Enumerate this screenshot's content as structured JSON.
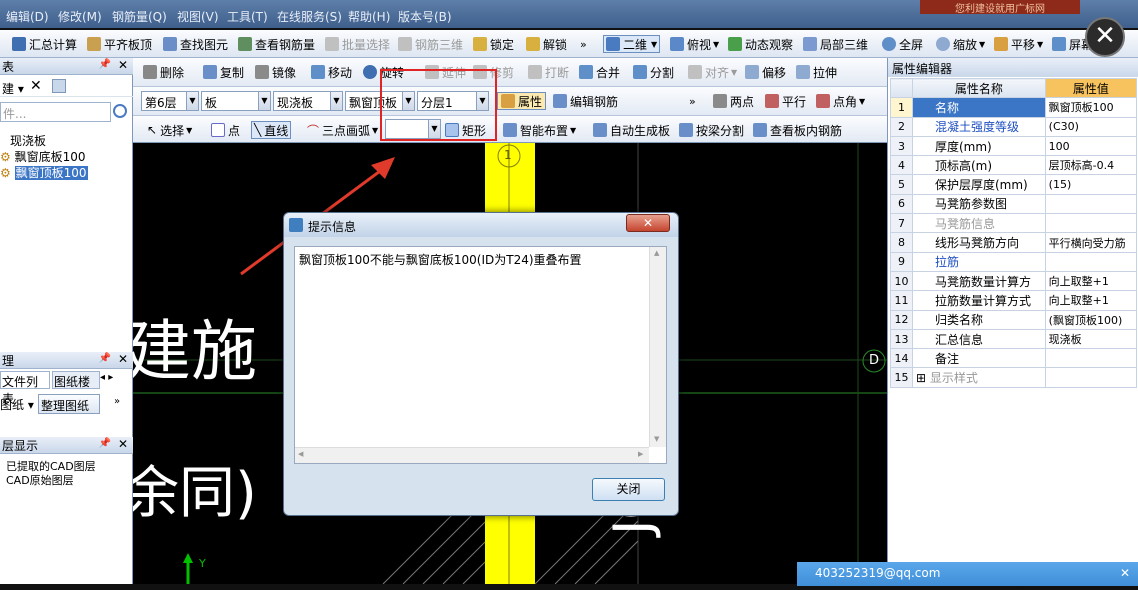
{
  "menubar": {
    "items": [
      "编辑(D)",
      "修改(M)",
      "钢筋量(Q)",
      "视图(V)",
      "工具(T)",
      "在线服务(S)",
      "帮助(H)",
      "版本号(B)"
    ],
    "warning": "您利建设就用广标网"
  },
  "toolbar1": {
    "sum_calc": "汇总计算",
    "flush_top": "平齐板顶",
    "find_element": "查找图元",
    "view_rebar": "查看钢筋量",
    "batch_select": "批量选择",
    "rebar_3d": "钢筋三维",
    "lock": "锁定",
    "unlock": "解锁",
    "view_2d": "二维",
    "top_view": "俯视",
    "dynamic_view": "动态观察",
    "local_3d": "局部三维",
    "fullscreen": "全屏",
    "zoom": "缩放",
    "pan": "平移",
    "screen": "屏幕"
  },
  "left_panel": {
    "top_header": "表",
    "new_label": "建",
    "search_placeholder": "件...",
    "tree_root": "现浇板",
    "tree_items": [
      "飘窗底板100",
      "飘窗顶板100"
    ],
    "mgmt_header": "理",
    "tabs": [
      "文件列表",
      "图纸楼"
    ],
    "drawing_btn": "图纸",
    "organize_btn": "整理图纸",
    "layer_header": "层显示",
    "layers": [
      "已提取的CAD图层",
      "CAD原始图层"
    ]
  },
  "toolbar2": {
    "delete": "删除",
    "copy": "复制",
    "mirror": "镜像",
    "move": "移动",
    "rotate": "旋转",
    "extend": "延伸",
    "trim": "修剪",
    "break": "打断",
    "merge": "合并",
    "split": "分割",
    "align": "对齐",
    "offset": "偏移",
    "stretch": "拉伸"
  },
  "toolbar3": {
    "floor": "第6层",
    "type": "板",
    "subtype": "现浇板",
    "component": "飘窗顶板",
    "layer": "分层1",
    "properties": "属性",
    "edit_rebar": "编辑钢筋",
    "two_points": "两点",
    "parallel": "平行",
    "point_angle": "点角"
  },
  "toolbar4": {
    "select": "选择",
    "point": "点",
    "line": "直线",
    "arc3": "三点画弧",
    "rect": "矩形",
    "smart_layout": "智能布置",
    "auto_generate": "自动生成板",
    "split_by_beam": "按梁分割",
    "view_inner_rebar": "查看板内钢筋"
  },
  "canvas": {
    "text_jianshi": "建施",
    "text_yutong": "余同)",
    "text_jc": "JC",
    "axis_1": "1",
    "axis_d": "D",
    "axis_y": "Y"
  },
  "dialog": {
    "title": "提示信息",
    "message": "飘窗顶板100不能与飘窗底板100(ID为T24)重叠布置",
    "close_button": "关闭",
    "titlebar_close": "✕"
  },
  "property_editor": {
    "title": "属性编辑器",
    "col_name": "属性名称",
    "col_value": "属性值",
    "rows": [
      {
        "num": "1",
        "name": "名称",
        "value": "飘窗顶板100"
      },
      {
        "num": "2",
        "name": "混凝土强度等级",
        "value": "(C30)"
      },
      {
        "num": "3",
        "name": "厚度(mm)",
        "value": "100"
      },
      {
        "num": "4",
        "name": "顶标高(m)",
        "value": "层顶标高-0.4"
      },
      {
        "num": "5",
        "name": "保护层厚度(mm)",
        "value": "(15)"
      },
      {
        "num": "6",
        "name": "马凳筋参数图",
        "value": ""
      },
      {
        "num": "7",
        "name": "马凳筋信息",
        "value": ""
      },
      {
        "num": "8",
        "name": "线形马凳筋方向",
        "value": "平行横向受力筋"
      },
      {
        "num": "9",
        "name": "拉筋",
        "value": ""
      },
      {
        "num": "10",
        "name": "马凳筋数量计算方",
        "value": "向上取整+1"
      },
      {
        "num": "11",
        "name": "拉筋数量计算方式",
        "value": "向上取整+1"
      },
      {
        "num": "12",
        "name": "归类名称",
        "value": "(飘窗顶板100)"
      },
      {
        "num": "13",
        "name": "汇总信息",
        "value": "现浇板"
      },
      {
        "num": "14",
        "name": "备注",
        "value": ""
      },
      {
        "num": "15",
        "name": "显示样式",
        "value": ""
      }
    ]
  },
  "chat": {
    "email": "403252319@qq.com",
    "close": "✕"
  },
  "overlay": {
    "close": "✕"
  },
  "colors": {
    "highlight_box": "#e02424",
    "arrow": "#e03a2a",
    "column_yellow": "#ffff00",
    "selected_row": "#3b75c6",
    "value_header": "#f7c35f"
  }
}
